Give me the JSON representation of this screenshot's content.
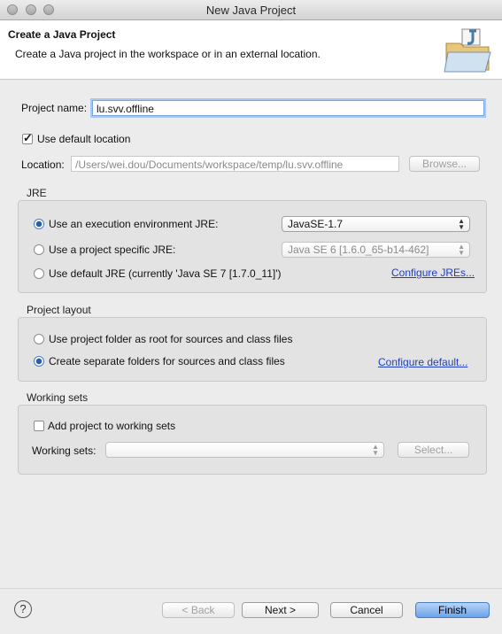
{
  "window": {
    "title": "New Java Project"
  },
  "header": {
    "title": "Create a Java Project",
    "subtitle": "Create a Java project in the workspace or in an external location.",
    "icon": "java-project-folder-icon"
  },
  "project": {
    "name_label": "Project name:",
    "name_value": "lu.svv.offline",
    "use_default_label": "Use default location",
    "use_default_checked": true,
    "location_label": "Location:",
    "location_value": "/Users/wei.dou/Documents/workspace/temp/lu.svv.offline",
    "browse_label": "Browse..."
  },
  "jre": {
    "title": "JRE",
    "option1": "Use an execution environment JRE:",
    "option1_value": "JavaSE-1.7",
    "option2": "Use a project specific JRE:",
    "option2_value": "Java SE 6 [1.6.0_65-b14-462]",
    "option3": "Use default JRE (currently 'Java SE 7 [1.7.0_11]')",
    "configure_link": "Configure JREs...",
    "selected": 1
  },
  "layout": {
    "title": "Project layout",
    "option1": "Use project folder as root for sources and class files",
    "option2": "Create separate folders for sources and class files",
    "configure_link": "Configure default...",
    "selected": 2
  },
  "working_sets": {
    "title": "Working sets",
    "add_label": "Add project to working sets",
    "add_checked": false,
    "sets_label": "Working sets:",
    "sets_value": "",
    "select_label": "Select..."
  },
  "footer": {
    "back": "< Back",
    "next": "Next >",
    "cancel": "Cancel",
    "finish": "Finish",
    "help_symbol": "?"
  },
  "colors": {
    "link": "#1f3fbf",
    "accent": "#6aa3ea"
  }
}
